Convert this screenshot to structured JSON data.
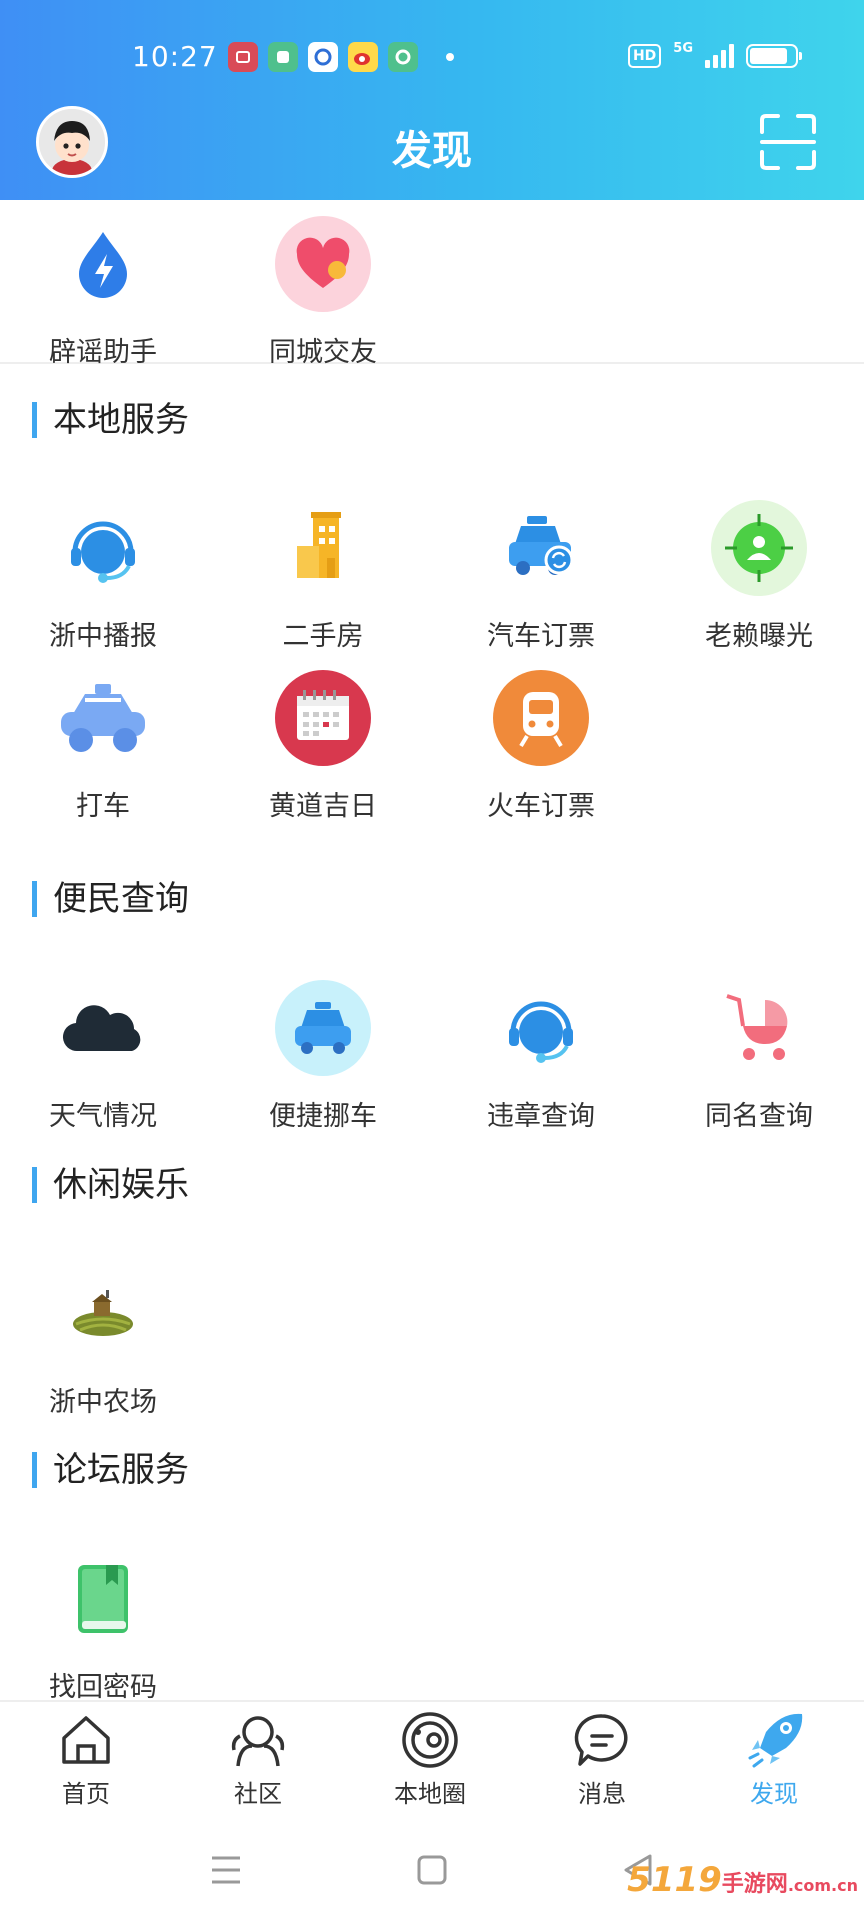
{
  "status_bar": {
    "time": "10:27",
    "hd": "HD",
    "network": "5G",
    "battery_level": 0.85,
    "notif_icons": [
      "app-red-icon",
      "app-green-icon",
      "app-blue-ring-icon",
      "weibo-icon",
      "app-green-ring-icon"
    ]
  },
  "header": {
    "title": "发现",
    "avatar_icon": "cartoon-avatar-icon",
    "scan_icon": "scan-icon"
  },
  "top_items": [
    {
      "label": "辟谣助手",
      "icon": "droplet-lightning-icon"
    },
    {
      "label": "同城交友",
      "icon": "heart-icon"
    }
  ],
  "sections": [
    {
      "title": "本地服务",
      "items": [
        {
          "label": "浙中播报",
          "icon": "headset-icon"
        },
        {
          "label": "二手房",
          "icon": "building-icon"
        },
        {
          "label": "汽车订票",
          "icon": "car-refresh-icon"
        },
        {
          "label": "老赖曝光",
          "icon": "target-person-icon"
        },
        {
          "label": "打车",
          "icon": "taxi-icon"
        },
        {
          "label": "黄道吉日",
          "icon": "calendar-icon"
        },
        {
          "label": "火车订票",
          "icon": "train-icon"
        }
      ]
    },
    {
      "title": "便民查询",
      "items": [
        {
          "label": "天气情况",
          "icon": "cloud-icon"
        },
        {
          "label": "便捷挪车",
          "icon": "car-icon"
        },
        {
          "label": "违章查询",
          "icon": "headset-icon"
        },
        {
          "label": "同名查询",
          "icon": "stroller-icon"
        }
      ]
    },
    {
      "title": "休闲娱乐",
      "items": [
        {
          "label": "浙中农场",
          "icon": "farm-icon"
        }
      ]
    },
    {
      "title": "论坛服务",
      "items": [
        {
          "label": "找回密码",
          "icon": "book-icon"
        }
      ]
    }
  ],
  "tabbar": [
    {
      "label": "首页",
      "icon": "home-icon",
      "active": false
    },
    {
      "label": "社区",
      "icon": "community-icon",
      "active": false
    },
    {
      "label": "本地圈",
      "icon": "planet-icon",
      "active": false
    },
    {
      "label": "消息",
      "icon": "message-icon",
      "active": false
    },
    {
      "label": "发现",
      "icon": "rocket-icon",
      "active": true
    }
  ],
  "watermark": {
    "main": "5119",
    "sub": "手游网",
    "domain": ".com.cn"
  },
  "colors": {
    "accent": "#3ea8ee",
    "header_start": "#3f8ff5",
    "header_end": "#3fd4ec"
  }
}
